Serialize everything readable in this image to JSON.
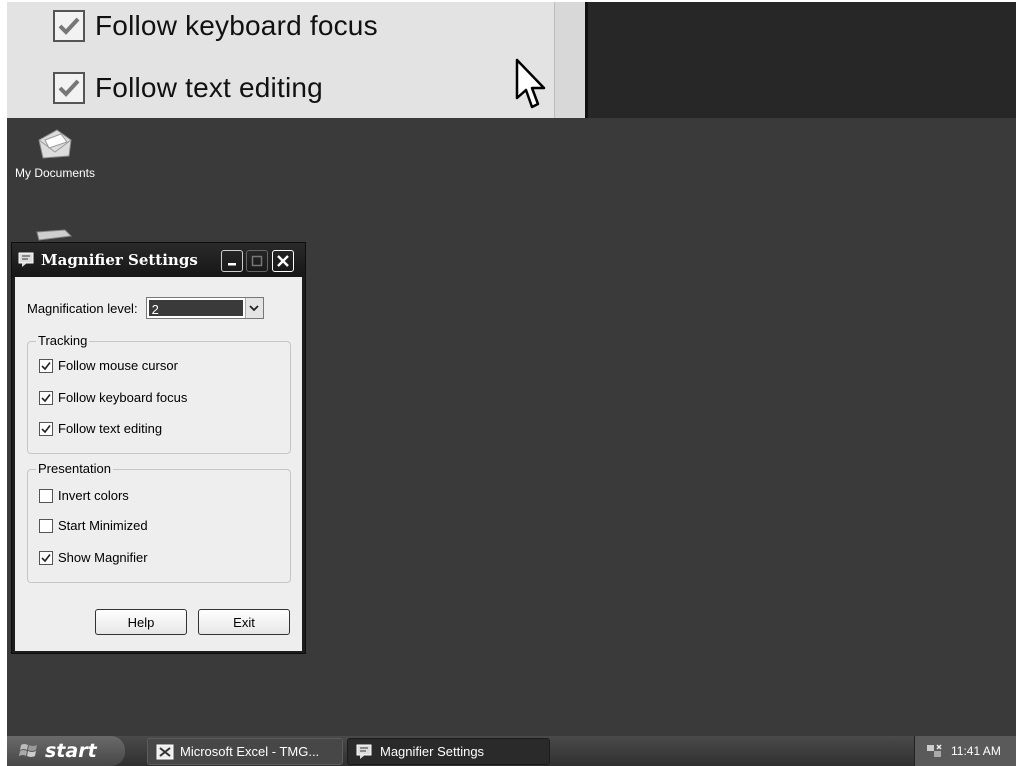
{
  "magnified_view": {
    "items": [
      {
        "label": "Follow keyboard focus",
        "checked": true
      },
      {
        "label": "Follow text editing",
        "checked": true
      }
    ]
  },
  "desktop": {
    "icons": [
      {
        "label": "My Documents",
        "icon": "my-documents-icon"
      }
    ]
  },
  "window": {
    "title": "Magnifier Settings",
    "magnification_label": "Magnification level:",
    "magnification_value": "2",
    "tracking": {
      "title": "Tracking",
      "items": [
        {
          "label": "Follow mouse cursor",
          "checked": true
        },
        {
          "label": "Follow keyboard focus",
          "checked": true
        },
        {
          "label": "Follow text editing",
          "checked": true
        }
      ]
    },
    "presentation": {
      "title": "Presentation",
      "items": [
        {
          "label": "Invert colors",
          "checked": false
        },
        {
          "label": "Start Minimized",
          "checked": false
        },
        {
          "label": "Show Magnifier",
          "checked": true
        }
      ]
    },
    "help_label": "Help",
    "exit_label": "Exit"
  },
  "taskbar": {
    "start_label": "start",
    "tasks": [
      {
        "label": "Microsoft Excel - TMG...",
        "icon": "excel-icon"
      },
      {
        "label": "Magnifier Settings",
        "icon": "magnifier-icon"
      }
    ],
    "clock": "11:41 AM"
  }
}
